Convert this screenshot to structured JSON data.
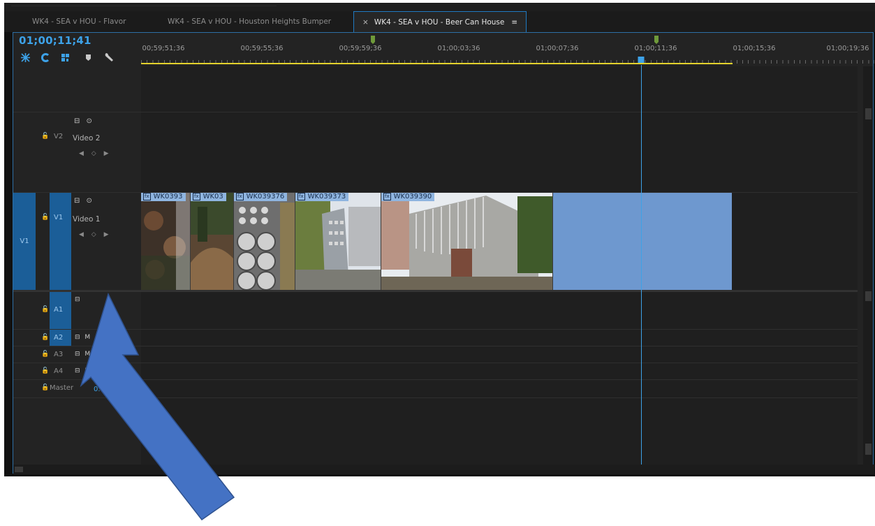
{
  "tabs": [
    {
      "label": "WK4 - SEA v HOU - Flavor",
      "active": false
    },
    {
      "label": "WK4 - SEA v HOU - Houston Heights Bumper",
      "active": false
    },
    {
      "label": "WK4 - SEA v HOU - Beer Can House",
      "active": true
    }
  ],
  "tab_close_glyph": "×",
  "tab_menu_glyph": "≡",
  "timecode": "01;00;11;41",
  "tool_icons": [
    "snap-icon",
    "linked-selection-icon",
    "add-marker-icon",
    "marker-icon",
    "wrench-icon"
  ],
  "ruler": {
    "ticks": [
      "00;59;51;36",
      "00;59;55;36",
      "00;59;59;36",
      "01;00;03;36",
      "01;00;07;36",
      "01;00;11;36",
      "01;00;15;36",
      "01;00;19;36"
    ]
  },
  "tracks": {
    "v2": {
      "label": "V2",
      "name": "Video 2",
      "icons": "⊟ ⊙",
      "keyframes": "◀ ◇ ▶"
    },
    "v1": {
      "source": "V1",
      "label": "V1",
      "name": "Video 1",
      "icons": "⊟ ⊙",
      "keyframes": "◀ ◇ ▶"
    },
    "audio": [
      {
        "label": "A1",
        "icons": "⊟"
      },
      {
        "label": "A2",
        "icons": "⊟ M"
      },
      {
        "label": "A3",
        "icons": "⊟ M"
      },
      {
        "label": "A4",
        "icons": "⊟ M S"
      }
    ],
    "master": {
      "label": "Master",
      "value": "0.0"
    },
    "lock_glyph": "🔓"
  },
  "clips": [
    {
      "label": "WK0393",
      "fx": "fx"
    },
    {
      "label": "WK03",
      "fx": "fx"
    },
    {
      "label": "WK039376",
      "fx": "fx"
    },
    {
      "label": "WK039373",
      "fx": "fx"
    },
    {
      "label": "WK039390",
      "fx": "fx"
    }
  ],
  "colors": {
    "accent": "#3da2e8",
    "track_target": "#1b5e98",
    "clip_label": "#8fb5e0",
    "empty_clip": "#6e98cf",
    "work_area": "#e3d22c",
    "marker": "#6f9a3a",
    "annotation_arrow": "#4472c4"
  }
}
